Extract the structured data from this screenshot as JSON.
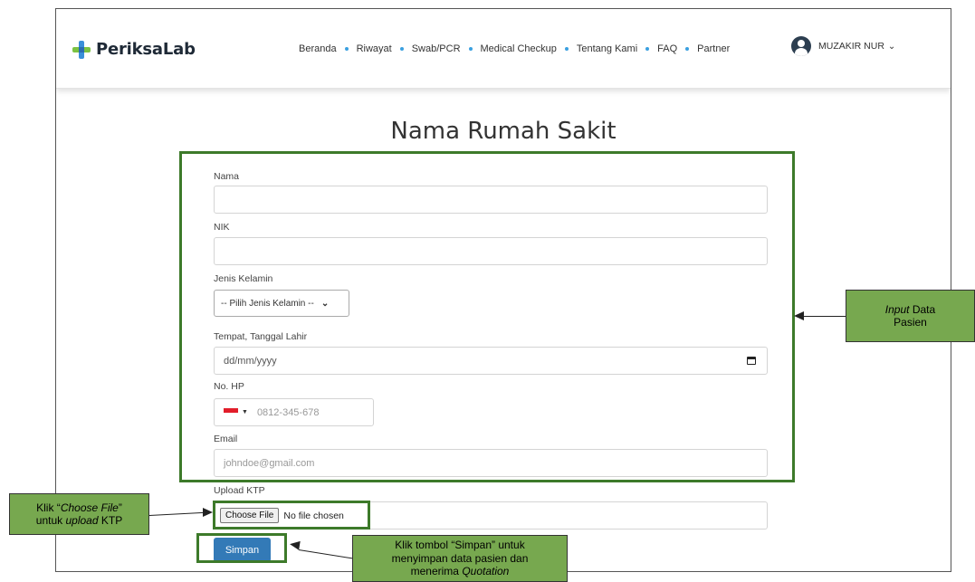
{
  "brand": {
    "name": "PeriksaLab"
  },
  "nav": {
    "items": [
      "Beranda",
      "Riwayat",
      "Swab/PCR",
      "Medical Checkup",
      "Tentang Kami",
      "FAQ",
      "Partner"
    ]
  },
  "user": {
    "name": "MUZAKIR NUR",
    "chevron": "⌄"
  },
  "page": {
    "title": "Nama Rumah Sakit"
  },
  "form": {
    "nama_label": "Nama",
    "nama_value": "",
    "nik_label": "NIK",
    "nik_value": "",
    "gender_label": "Jenis Kelamin",
    "gender_selected": "-- Pilih Jenis Kelamin --",
    "dob_label": "Tempat, Tanggal Lahir",
    "dob_placeholder": "dd/mm/yyyy",
    "phone_label": "No. HP",
    "phone_placeholder": "0812-345-678",
    "email_label": "Email",
    "email_placeholder": "johndoe@gmail.com",
    "ktp_label": "Upload KTP",
    "choose_file_label": "Choose File",
    "no_file_text": "No file chosen",
    "submit_label": "Simpan"
  },
  "annotations": {
    "input_data": {
      "italic": "Input",
      "rest1": " Data",
      "rest2": "Pasien"
    },
    "choose_file": {
      "line1_a": "Klik “",
      "line1_b": "Choose File",
      "line1_c": "”",
      "line2_a": "untuk ",
      "line2_b": "upload",
      "line2_c": " KTP"
    },
    "simpan": {
      "line1": "Klik tombol “Simpan” untuk",
      "line2": "menyimpan data pasien dan",
      "line3_a": "menerima ",
      "line3_b": "Quotation"
    }
  },
  "colors": {
    "accent": "#337ab7",
    "highlight": "#3d7a2a",
    "callout": "#77a84f",
    "nav_dot": "#3aa0e0"
  },
  "icons": {
    "logo": "plus-logo-icon",
    "avatar": "user-avatar-icon",
    "calendar": "calendar-icon",
    "flag": "indonesia-flag-icon"
  }
}
